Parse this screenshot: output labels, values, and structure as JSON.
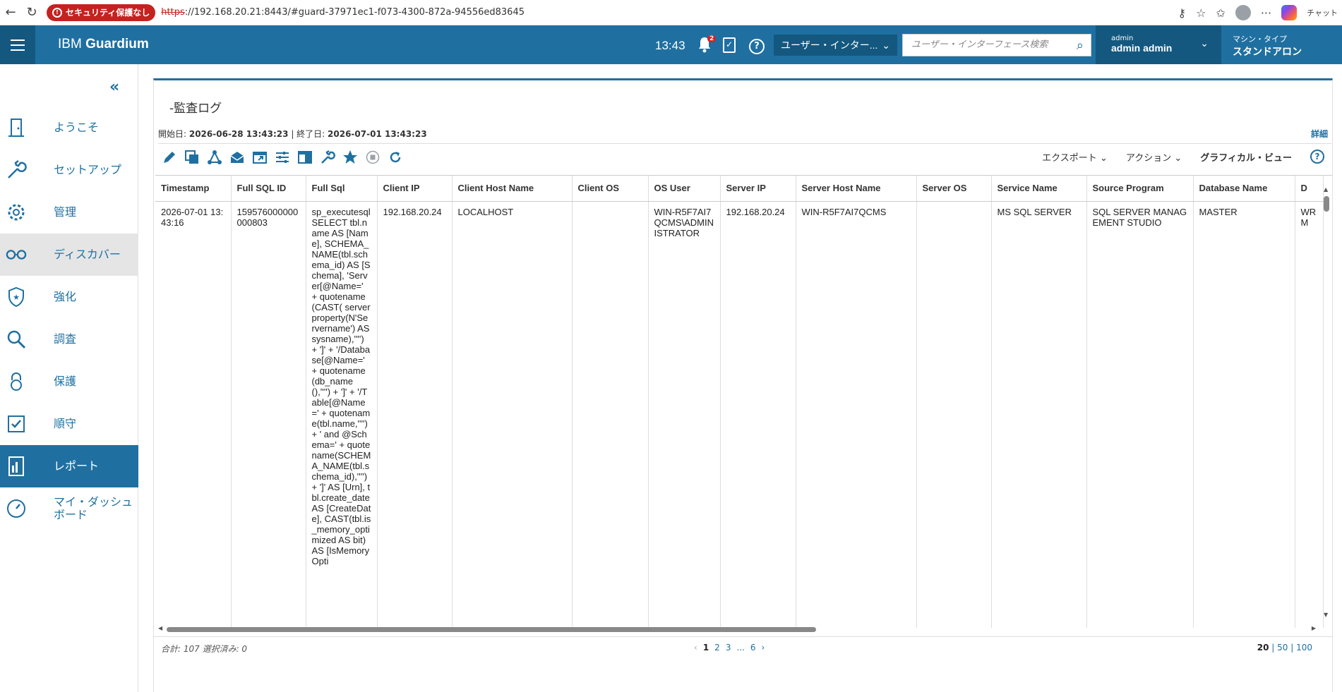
{
  "browser": {
    "security_label": "セキュリティ保護なし",
    "url_scheme": "https",
    "url_rest": "://192.168.20.21:8443/#guard-37971ec1-f073-4300-872a-94556ed83645",
    "right_label": "チャット"
  },
  "header": {
    "brand_prefix": "IBM ",
    "brand_name": "Guardium",
    "time": "13:43",
    "notification_count": "2",
    "ui_select": "ユーザー・インター...",
    "search_placeholder": "ユーザー・インターフェース検索",
    "user_small": "admin",
    "user_name": "admin admin",
    "machine_type_label": "マシン・タイプ",
    "machine_type_value": "スタンドアロン"
  },
  "sidebar": {
    "items": [
      {
        "label": "ようこそ",
        "icon": "door-icon"
      },
      {
        "label": "セットアップ",
        "icon": "wrench-icon"
      },
      {
        "label": "管理",
        "icon": "gear-icon"
      },
      {
        "label": "ディスカバー",
        "icon": "glasses-icon"
      },
      {
        "label": "強化",
        "icon": "shield-star-icon"
      },
      {
        "label": "調査",
        "icon": "magnifier-icon"
      },
      {
        "label": "保護",
        "icon": "lock-icon"
      },
      {
        "label": "順守",
        "icon": "checkbox-icon"
      },
      {
        "label": "レポート",
        "icon": "report-icon"
      },
      {
        "label": "マイ・ダッシュ\nボード",
        "icon": "dashboard-icon"
      }
    ]
  },
  "report": {
    "title": "-監査ログ",
    "start_label": "開始日: ",
    "start_value": "2026-06-28 13:43:23",
    "separator": " | ",
    "end_label": "終了日: ",
    "end_value": "2026-07-01 13:43:23",
    "detail_link": "詳細",
    "export_label": "エクスポート",
    "action_label": "アクション",
    "graphical_view": "グラフィカル・ビュー",
    "help_symbol": "?"
  },
  "table": {
    "columns": [
      "Timestamp",
      "Full SQL ID",
      "Full Sql",
      "Client IP",
      "Client Host Name",
      "Client OS",
      "OS User",
      "Server IP",
      "Server Host Name",
      "Server OS",
      "Service Name",
      "Source Program",
      "Database Name",
      "D"
    ],
    "rows": [
      [
        "2026-07-01 13:43:16",
        "159576000000000803",
        "sp_executesql SELECT tbl.name AS [Name], SCHEMA_NAME(tbl.schema_id) AS [Schema], 'Server[@Name=' + quotename(CAST( serverproperty(N'Servername') AS sysname),'''') + ']' + '/Database[@Name=' + quotename(db_name(),'''') + ']' + '/Table[@Name=' + quotename(tbl.name,'''') + ' and @Schema=' + quotename(SCHEMA_NAME(tbl.schema_id),'''') + ']' AS [Urn], tbl.create_date AS [CreateDate], CAST(tbl.is_memory_optimized AS bit) AS [IsMemoryOpti",
        "192.168.20.24",
        "LOCALHOST",
        "",
        "WIN-R5F7AI7QCMS\\ADMINISTRATOR",
        "192.168.20.24",
        "WIN-R5F7AI7QCMS",
        "",
        "MS SQL SERVER",
        "SQL SERVER MANAGEMENT STUDIO",
        "MASTER",
        "WRM"
      ]
    ]
  },
  "footer": {
    "total": "合計: 107 選択済み: 0",
    "prev": "‹",
    "pages": [
      "1",
      "2",
      "3"
    ],
    "ellipsis": "...",
    "last_page": "6",
    "next": "›",
    "size_current": "20",
    "size_sep": " | ",
    "size_50": "50",
    "size_100": "100"
  }
}
